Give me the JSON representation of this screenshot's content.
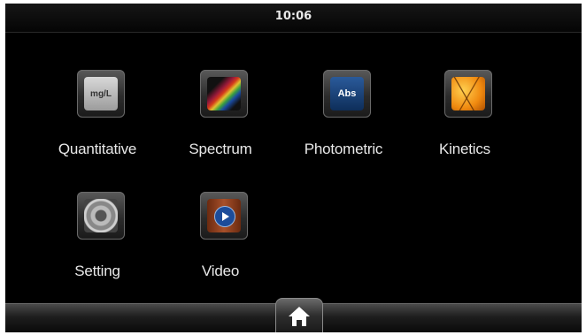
{
  "statusbar": {
    "time": "10:06"
  },
  "apps": [
    {
      "label": "Quantitative",
      "icon": "mg-per-liter-icon",
      "icon_text": "mg/L"
    },
    {
      "label": "Spectrum",
      "icon": "spectrum-icon"
    },
    {
      "label": "Photometric",
      "icon": "abs-icon",
      "icon_text": "Abs"
    },
    {
      "label": "Kinetics",
      "icon": "kinetics-icon"
    },
    {
      "label": "Setting",
      "icon": "gear-icon"
    },
    {
      "label": "Video",
      "icon": "video-play-icon"
    }
  ],
  "bottombar": {
    "home_icon": "home-icon"
  }
}
